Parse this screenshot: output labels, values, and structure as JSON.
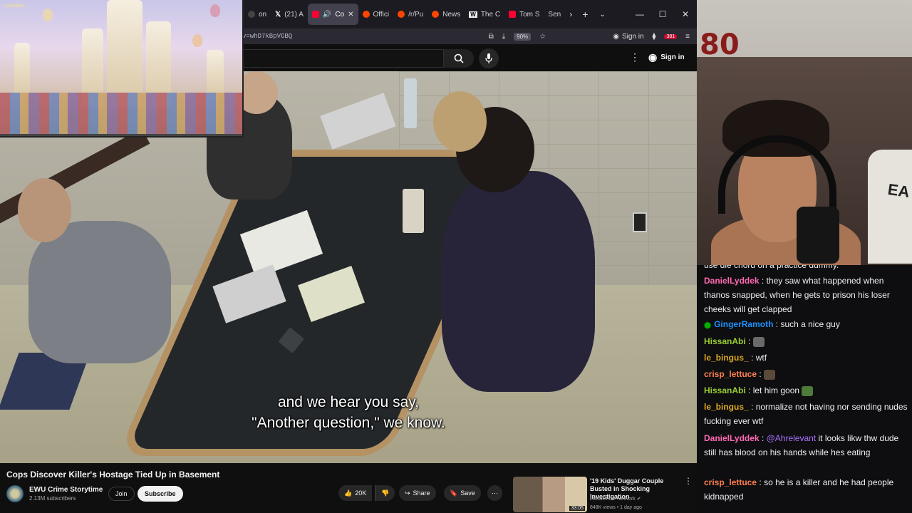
{
  "browser": {
    "tabs": [
      {
        "label": "on",
        "color": "#444",
        "active": false
      },
      {
        "label": "(21) A",
        "color": "#000",
        "active": false
      },
      {
        "label": "Co",
        "color": "#ff0033",
        "active": true
      },
      {
        "label": "Offici",
        "color": "#ff4500",
        "active": false
      },
      {
        "label": "/r/Pu",
        "color": "#ff4500",
        "active": false
      },
      {
        "label": "News",
        "color": "#ff4500",
        "active": false
      },
      {
        "label": "The C",
        "color": "#666",
        "active": false
      },
      {
        "label": "Tom S",
        "color": "#ff0033",
        "active": false
      },
      {
        "label": "Sen",
        "color": "#444",
        "active": false
      }
    ],
    "url": "v=whD7kBpVGBQ",
    "zoom": "90%",
    "signin": "Sign in",
    "ext_badge": "381"
  },
  "youtube": {
    "signin": "Sign in",
    "caption_line1": "and we hear you say,",
    "caption_line2": "\"Another question,\" we know.",
    "video_title": "Cops Discover Killer's Hostage Tied Up in Basement",
    "channel": "EWU Crime Storytime",
    "subscribers": "2.13M subscribers",
    "join": "Join",
    "subscribe": "Subscribe",
    "likes": "20K",
    "share": "Share",
    "save": "Save",
    "rec": {
      "title": "'19 Kids' Duggar Couple Busted in Shocking Investigation",
      "channel": "Law&Crime Network",
      "views": "848K views • 1 day ago",
      "duration": "33:05"
    }
  },
  "pip": {
    "label": "LOADING..."
  },
  "webcam": {
    "number": "80",
    "shirt": "EA"
  },
  "chat": {
    "cut_text": "use die chord on a practice dummy.",
    "messages": [
      {
        "user": "DanielLyddek",
        "color": "#ff69b4",
        "text": "they saw what happened when thanos snapped, when he gets to prison his loser cheeks will get clapped",
        "emote": ""
      },
      {
        "user": "GingerRamoth",
        "color": "#1e90ff",
        "text": "such a nice guy",
        "emote": "",
        "badge": true
      },
      {
        "user": "HissanAbi",
        "color": "#9acd32",
        "text": "",
        "emote": "#6a6a6a"
      },
      {
        "user": "le_bingus_",
        "color": "#daa520",
        "text": "wtf",
        "emote": ""
      },
      {
        "user": "crisp_lettuce",
        "color": "#ff7f50",
        "text": "",
        "emote": "#5a4a3a"
      },
      {
        "user": "HissanAbi",
        "color": "#9acd32",
        "text": "let him goon",
        "emote": "#4e7a3a"
      },
      {
        "user": "le_bingus_",
        "color": "#daa520",
        "text": "normalize not having nor sending nudes fucking ever wtf",
        "emote": ""
      },
      {
        "user": "DanielLyddek",
        "color": "#ff69b4",
        "text": "it looks likw thw dude still has blood on his hands while hes eating",
        "mention": "@Ahrelevant",
        "emote": ""
      },
      {
        "user": "crisp_lettuce",
        "color": "#ff7f50",
        "text": "so he is a killer and he had people kidnapped",
        "emote": ""
      }
    ]
  }
}
